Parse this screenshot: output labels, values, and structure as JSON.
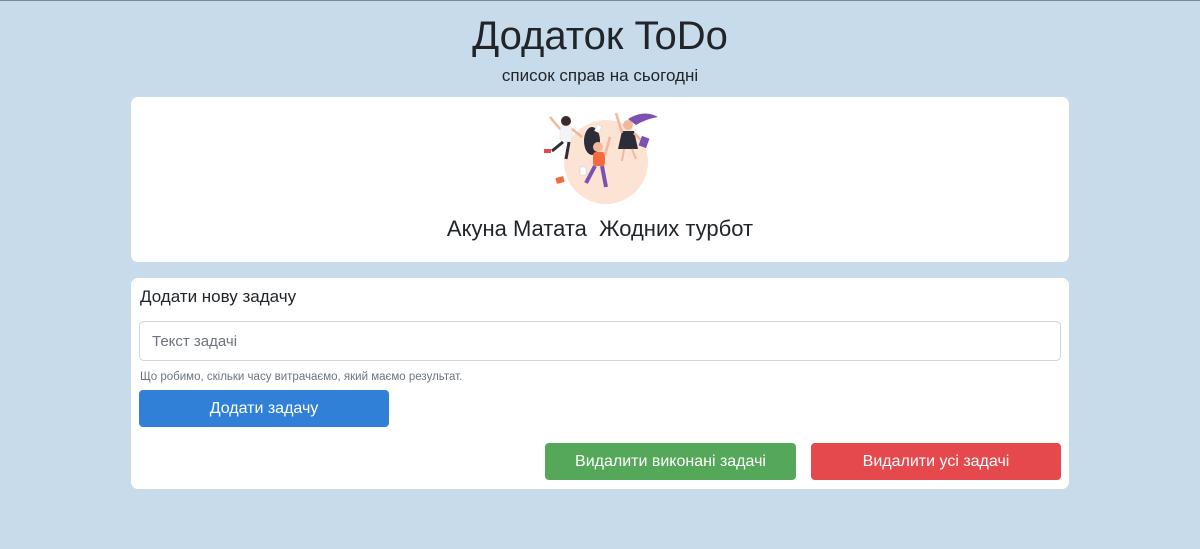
{
  "header": {
    "title": "Додаток ToDo",
    "subtitle": "список справ на сьогодні"
  },
  "hero": {
    "illustration": "people-jumping-celebration-illustration",
    "caption": "Акуна Матата  Жодних турбот"
  },
  "form": {
    "heading": "Додати нову задачу",
    "task_input": {
      "value": "",
      "placeholder": "Текст задачі"
    },
    "help_text": "Що робимо, скільки часу витрачаємо, який маємо результат.",
    "add_button_label": "Додати задачу",
    "delete_done_label": "Видалити виконані задачі",
    "delete_all_label": "Видалити усі задачі"
  },
  "colors": {
    "background": "#c8dbea",
    "primary": "#3180d8",
    "success": "#55a85a",
    "danger": "#e5494d"
  }
}
